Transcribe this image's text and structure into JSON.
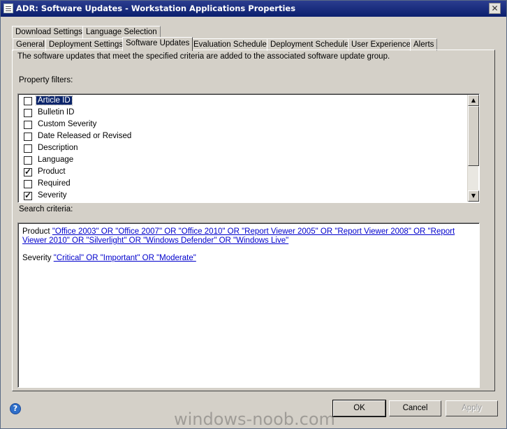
{
  "window": {
    "title": "ADR: Software Updates - Workstation Applications Properties",
    "close_glyph": "✕"
  },
  "tabs": {
    "row1": [
      {
        "label": "Download Settings"
      },
      {
        "label": "Language Selection"
      }
    ],
    "row2": [
      {
        "label": "General"
      },
      {
        "label": "Deployment Settings"
      },
      {
        "label": "Software Updates",
        "active": true
      },
      {
        "label": "Evaluation Schedule"
      },
      {
        "label": "Deployment Schedule"
      },
      {
        "label": "User Experience"
      },
      {
        "label": "Alerts"
      }
    ]
  },
  "main": {
    "description": "The software updates that meet the specified criteria are added to the associated software update group.",
    "property_filters_label": "Property filters:",
    "filters": [
      {
        "label": "Article ID",
        "checked": false,
        "selected": true
      },
      {
        "label": "Bulletin ID",
        "checked": false
      },
      {
        "label": "Custom Severity",
        "checked": false
      },
      {
        "label": "Date Released or Revised",
        "checked": false
      },
      {
        "label": "Description",
        "checked": false
      },
      {
        "label": "Language",
        "checked": false
      },
      {
        "label": "Product",
        "checked": true
      },
      {
        "label": "Required",
        "checked": false
      },
      {
        "label": "Severity",
        "checked": true
      }
    ],
    "search_criteria_label": "Search criteria:",
    "criteria": [
      {
        "property": "Product",
        "value": "\"Office 2003\" OR \"Office 2007\" OR \"Office 2010\" OR \"Report Viewer 2005\" OR \"Report Viewer 2008\" OR \"Report Viewer 2010\" OR \"Silverlight\" OR \"Windows Defender\" OR \"Windows Live\""
      },
      {
        "property": "Severity",
        "value": "\"Critical\" OR \"Important\" OR \"Moderate\""
      }
    ]
  },
  "footer": {
    "help_glyph": "?",
    "ok_label": "OK",
    "cancel_label": "Cancel",
    "apply_label": "Apply",
    "apply_enabled": false
  },
  "watermark": "windows-noob.com",
  "icons": [
    "window-icon",
    "close-icon",
    "help-icon",
    "scroll-up-icon",
    "scroll-down-icon",
    "checkbox-icon"
  ],
  "colors": {
    "title_bar": "#0b1f6e",
    "link": "#0000cc",
    "selection": "#0a246a",
    "dialog_bg": "#d4d0c8"
  }
}
